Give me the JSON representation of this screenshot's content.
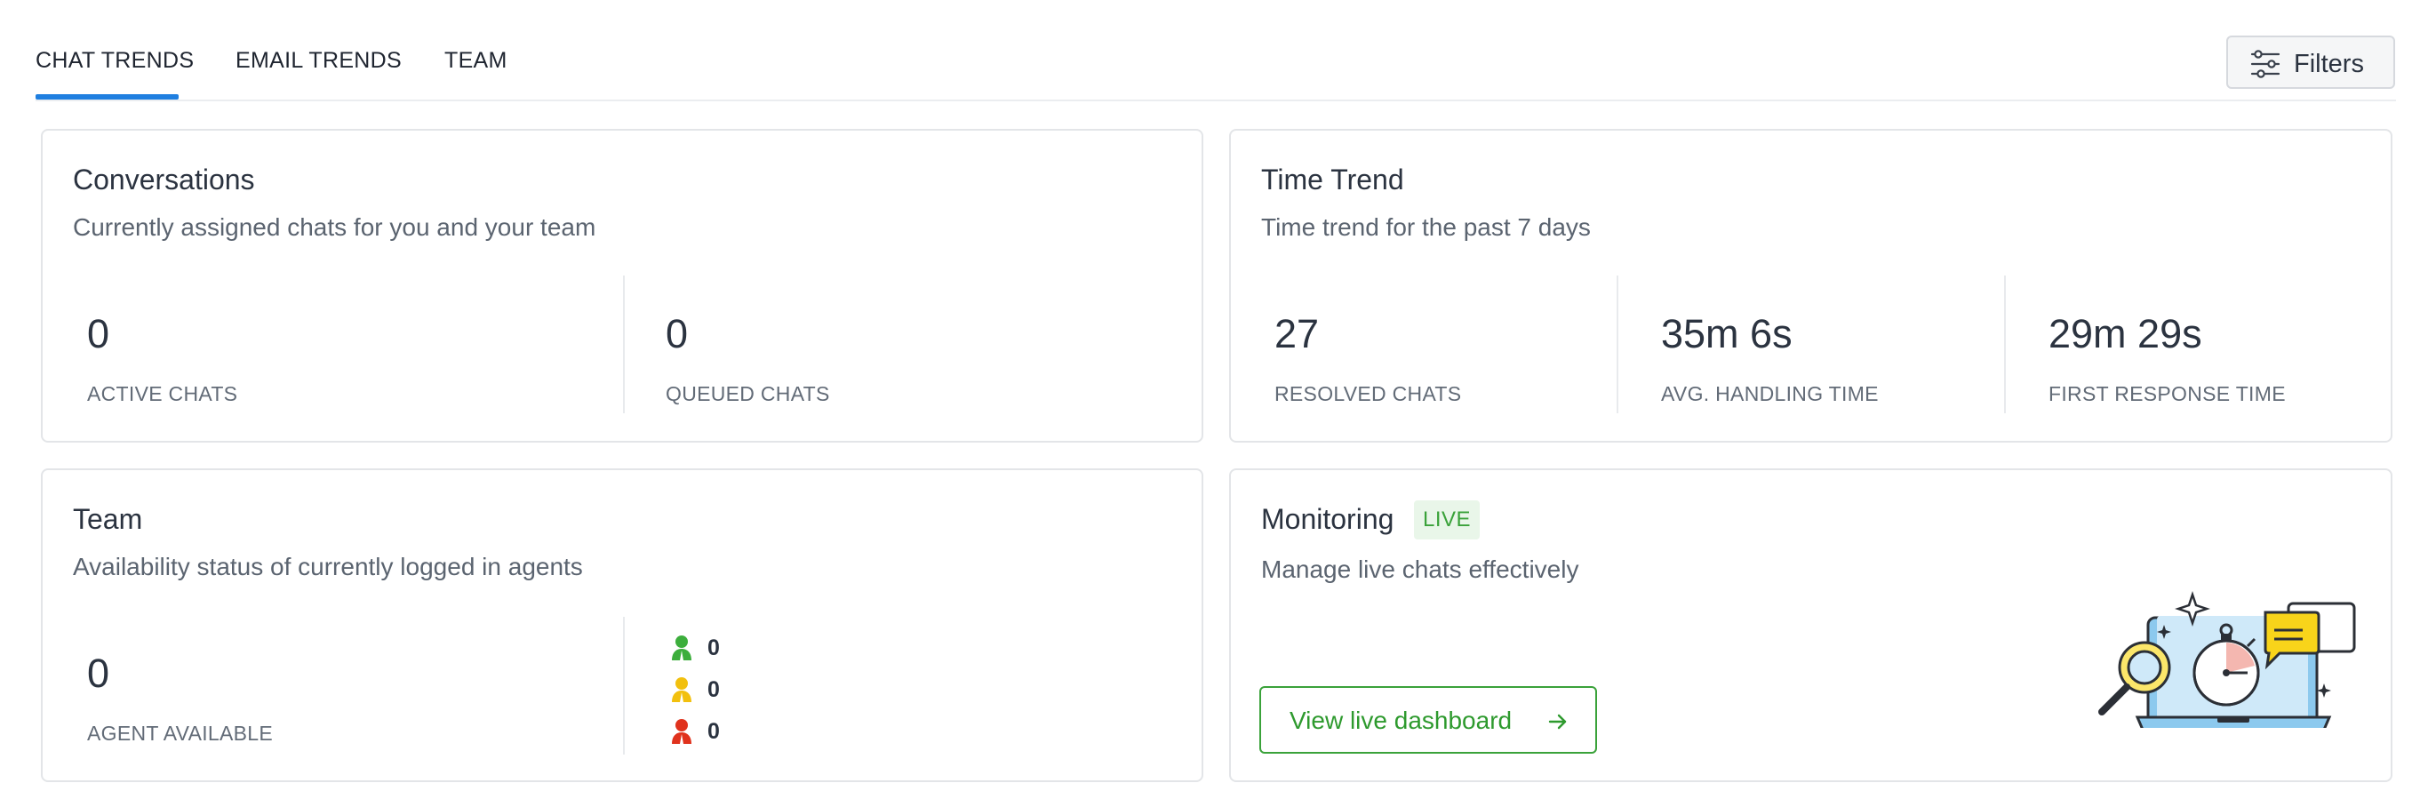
{
  "tabs": [
    {
      "label": "CHAT TRENDS",
      "active": true
    },
    {
      "label": "EMAIL TRENDS",
      "active": false
    },
    {
      "label": "TEAM",
      "active": false
    }
  ],
  "filters": {
    "label": "Filters",
    "icon": "sliders-icon"
  },
  "conversations": {
    "title": "Conversations",
    "subtitle": "Currently assigned chats for you and your team",
    "metrics": [
      {
        "value": "0",
        "label": "ACTIVE CHATS"
      },
      {
        "value": "0",
        "label": "QUEUED CHATS"
      }
    ]
  },
  "time_trend": {
    "title": "Time Trend",
    "subtitle": "Time trend for the past 7 days",
    "metrics": [
      {
        "value": "27",
        "label": "RESOLVED CHATS"
      },
      {
        "value": "35m 6s",
        "label": "AVG. HANDLING TIME"
      },
      {
        "value": "29m 29s",
        "label": "FIRST RESPONSE TIME"
      }
    ]
  },
  "team": {
    "title": "Team",
    "subtitle": "Availability status of currently logged in agents",
    "metric": {
      "value": "0",
      "label": "AGENT AVAILABLE"
    },
    "statuses": [
      {
        "color": "#3cae3c",
        "count": "0",
        "icon": "agent-available-icon"
      },
      {
        "color": "#f2c00e",
        "count": "0",
        "icon": "agent-away-icon"
      },
      {
        "color": "#e0321d",
        "count": "0",
        "icon": "agent-busy-icon"
      }
    ]
  },
  "monitoring": {
    "title": "Monitoring",
    "badge": "LIVE",
    "subtitle": "Manage live chats effectively",
    "button_label": "View live dashboard",
    "illustration": "monitoring-illustration"
  },
  "colors": {
    "accent": "#1f7fe0",
    "live_green": "#3aa23a"
  }
}
